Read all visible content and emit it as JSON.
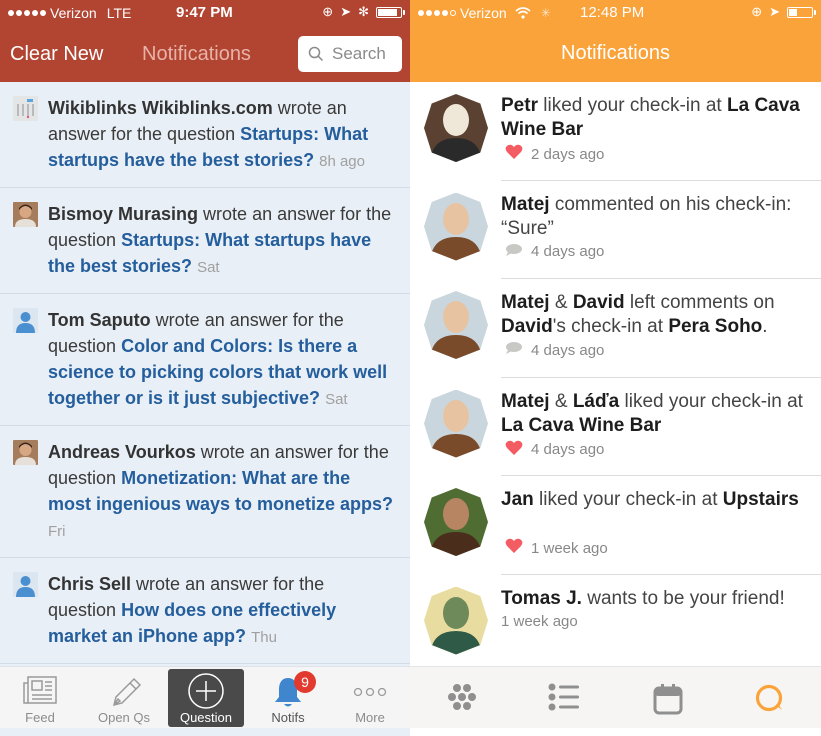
{
  "left_app": {
    "statusbar": {
      "carrier": "Verizon",
      "network": "LTE",
      "time": "9:47 PM",
      "signal_bars": 5,
      "signal_max": 5,
      "battery_percent": 90
    },
    "header": {
      "clear_new_label": "Clear New",
      "title": "Notifications",
      "search_placeholder": "Search"
    },
    "notifications": [
      {
        "author": "Wikiblinks Wikiblinks.com",
        "action": "wrote an answer for the question",
        "question": "Startups: What startups have the best stories?",
        "when": "8h ago",
        "avatar": "wikiblinks-avatar"
      },
      {
        "author": "Bismoy Murasing",
        "action": "wrote an answer for the question",
        "question": "Startups: What startups have the best stories?",
        "when": "Sat",
        "avatar": "photo-avatar"
      },
      {
        "author": "Tom Saputo",
        "action": "wrote an answer for the question",
        "question": "Color and Colors: Is there a science to picking colors that work well together or is it just subjective?",
        "when": "Sat",
        "avatar": "default-user-avatar"
      },
      {
        "author": "Andreas Vourkos",
        "action": "wrote an answer for the question",
        "question": "Monetization: What are the most ingenious ways to monetize apps?",
        "when": "Fri",
        "avatar": "photo-avatar"
      },
      {
        "author": "Chris Sell",
        "action": "wrote an answer for the question",
        "question": "How does one effectively market an iPhone app?",
        "when": "Thu",
        "avatar": "default-user-avatar"
      }
    ],
    "tabbar": [
      {
        "label": "Feed",
        "icon": "newspaper-icon",
        "active": false
      },
      {
        "label": "Open Qs",
        "icon": "pencil-icon",
        "active": false
      },
      {
        "label": "Question",
        "icon": "plus-circle-icon",
        "active": true
      },
      {
        "label": "Notifs",
        "icon": "bell-icon",
        "active": false,
        "badge": "9"
      },
      {
        "label": "More",
        "icon": "more-dots-icon",
        "active": false
      }
    ],
    "colors": {
      "header": "#b24432",
      "link": "#245e9c",
      "list_bg": "#e9eff6",
      "badge": "#e23a2e"
    }
  },
  "right_app": {
    "statusbar": {
      "carrier": "Verizon",
      "time": "12:48 PM",
      "signal_bars": 4,
      "signal_max": 5,
      "battery_percent": 35
    },
    "header": {
      "title": "Notifications"
    },
    "notifications": [
      {
        "parts": [
          {
            "t": "Petr",
            "b": true
          },
          {
            "t": " liked your check-in at "
          },
          {
            "t": "La Cava Wine Bar",
            "b": true
          }
        ],
        "meta_icon": "heart-icon",
        "when": "2 days ago"
      },
      {
        "parts": [
          {
            "t": "Matej",
            "b": true
          },
          {
            "t": " commented on his check-in: “Sure”"
          }
        ],
        "meta_icon": "comment-icon",
        "when": "4 days ago"
      },
      {
        "parts": [
          {
            "t": "Matej",
            "b": true
          },
          {
            "t": " & "
          },
          {
            "t": "David",
            "b": true
          },
          {
            "t": " left comments on "
          },
          {
            "t": "David",
            "b": true
          },
          {
            "t": "'s check-in at "
          },
          {
            "t": "Pera Soho",
            "b": true
          },
          {
            "t": "."
          }
        ],
        "meta_icon": "comment-icon",
        "when": "4 days ago"
      },
      {
        "parts": [
          {
            "t": "Matej",
            "b": true
          },
          {
            "t": " & "
          },
          {
            "t": "Láďa",
            "b": true
          },
          {
            "t": " liked your check-in at "
          },
          {
            "t": "La Cava Wine Bar",
            "b": true
          }
        ],
        "meta_icon": "heart-icon",
        "when": "4 days ago"
      },
      {
        "parts": [
          {
            "t": "Jan",
            "b": true
          },
          {
            "t": " liked your check-in at "
          },
          {
            "t": "Upstairs",
            "b": true
          }
        ],
        "meta_icon": "heart-icon",
        "when": "1 week ago"
      },
      {
        "parts": [
          {
            "t": "Tomas J.",
            "b": true
          },
          {
            "t": " wants to be your friend!"
          }
        ],
        "meta_icon": "",
        "when": "1 week ago"
      }
    ],
    "tabbar": [
      {
        "icon": "bubbles-icon",
        "active": false
      },
      {
        "icon": "list-icon",
        "active": false
      },
      {
        "icon": "calendar-icon",
        "active": false
      },
      {
        "icon": "swarm-chat-icon",
        "active": true
      }
    ],
    "colors": {
      "header": "#fba33b",
      "heart": "#f25c62",
      "active_tab": "#fba33b",
      "inactive_tab": "#8f8f8f"
    }
  }
}
